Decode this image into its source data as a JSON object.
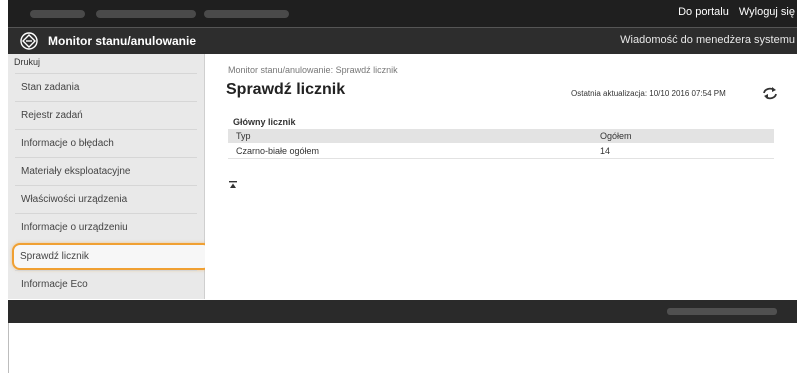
{
  "topbar": {
    "links": [
      "Do portalu",
      "Wyloguj się"
    ]
  },
  "titlebar": {
    "title": "Monitor stanu/anulowanie",
    "message_link": "Wiadomość do menedżera systemu"
  },
  "sidebar": {
    "header": "Drukuj",
    "items": [
      {
        "label": "Stan zadania"
      },
      {
        "label": "Rejestr zadań"
      },
      {
        "label": "Informacje o błędach"
      },
      {
        "label": "Materiały eksploatacyjne"
      },
      {
        "label": "Właściwości urządzenia"
      },
      {
        "label": "Informacje o urządzeniu"
      },
      {
        "label": "Sprawdź licznik",
        "selected": true
      },
      {
        "label": "Informacje Eco"
      }
    ]
  },
  "main": {
    "breadcrumb": "Monitor stanu/anulowanie: Sprawdź licznik",
    "title": "Sprawdź licznik",
    "last_update": "Ostatnia aktualizacja: 10/10 2016 07:54 PM",
    "section_title": "Główny licznik",
    "table": {
      "headers": [
        "Typ",
        "Ogółem"
      ],
      "rows": [
        [
          "Czarno-białe ogółem",
          "14"
        ]
      ]
    }
  },
  "colors": {
    "topbar": "#1f1f1f",
    "titlebar": "#2d2d2d",
    "sidebar": "#e9e9e9",
    "highlight": "#f0a032"
  },
  "icons": {
    "logo": "diamond-logo-icon",
    "refresh": "refresh-icon",
    "collapse": "collapse-icon"
  }
}
